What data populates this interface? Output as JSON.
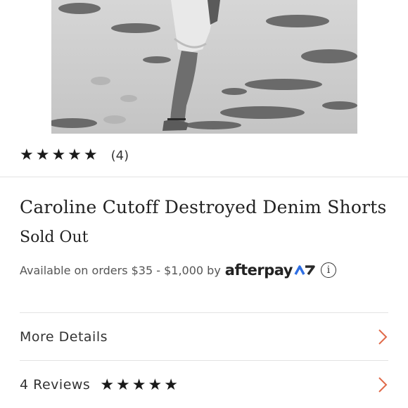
{
  "product": {
    "image_alt": "Black and white photo of legs in cutoff shorts on a sandy beach",
    "rating_stars": "★★★★★",
    "review_count": "(4)",
    "title": "Caroline Cutoff Destroyed Denim Shorts",
    "availability": "Sold Out"
  },
  "afterpay": {
    "text": "Available on orders $35 - $1,000 by",
    "logo": "afterpay",
    "info_icon": "info-icon"
  },
  "accordion": [
    {
      "label": "More Details",
      "icon": "chevron-right-icon"
    },
    {
      "label": "4 Reviews",
      "stars": "★★★★★",
      "icon": "chevron-right-icon"
    }
  ],
  "colors": {
    "accent": "#e06a4a",
    "afterpay_mark": "#2f6fe4",
    "divider": "#e3e3e3"
  }
}
